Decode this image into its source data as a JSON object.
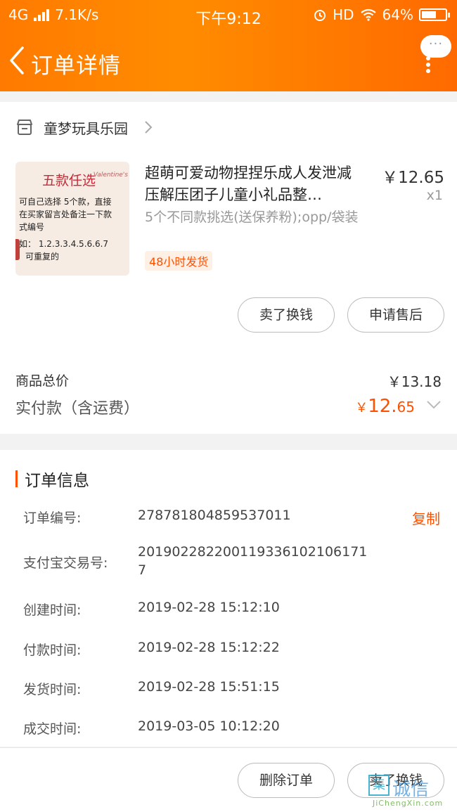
{
  "status_bar": {
    "network": "4G",
    "speed": "7.1K/s",
    "time": "下午9:12",
    "hd": "HD",
    "battery": "64%",
    "battery_level": 0.64
  },
  "nav": {
    "title": "订单详情",
    "more_dots": "···"
  },
  "shop": {
    "name": "童梦玩具乐园"
  },
  "product": {
    "image": {
      "title": "五款任选",
      "lines": [
        "可自己选择 5个款，直接",
        "在买家留言处备注一下款",
        "式编号",
        "如： 1.2.3.3.4.5.6.6.7",
        "可重复的"
      ],
      "script": "Valentine's"
    },
    "title": "超萌可爱动物捏捏乐成人发泄减压解压团子儿童小礼品整…",
    "sku": "5个不同款挑选(送保养粉);opp/袋装",
    "tag": "48小时发货",
    "price": "￥12.65",
    "qty": "x1"
  },
  "actions": {
    "sell": "卖了换钱",
    "after_sale": "申请售后"
  },
  "summary": {
    "total_label": "商品总价",
    "total_value": "￥13.18",
    "paid_label": "实付款（含运费）",
    "paid_currency": "￥",
    "paid_int": "12.",
    "paid_dec": "65"
  },
  "info": {
    "title": "订单信息",
    "copy": "复制",
    "rows": [
      {
        "label": "订单编号:",
        "value": "278781804859537011"
      },
      {
        "label": "支付宝交易号:",
        "value": "20190228220011933610210617 1",
        "value_line1": "201902282200119336102106171",
        "value_line2": "7"
      },
      {
        "label": "创建时间:",
        "value": "2019-02-28 15:12:10"
      },
      {
        "label": "付款时间:",
        "value": "2019-02-28 15:12:22"
      },
      {
        "label": "发货时间:",
        "value": "2019-02-28 15:51:15"
      },
      {
        "label": "成交时间:",
        "value": "2019-03-05 10:12:20"
      }
    ]
  },
  "bottom": {
    "delete": "删除订单",
    "sell": "卖了换钱"
  },
  "watermark": {
    "glyph": "集",
    "text": "诚信",
    "url": "JiChengXin.com"
  },
  "colors": {
    "header_orange": "#ff7a00",
    "accent": "#ff5000"
  }
}
